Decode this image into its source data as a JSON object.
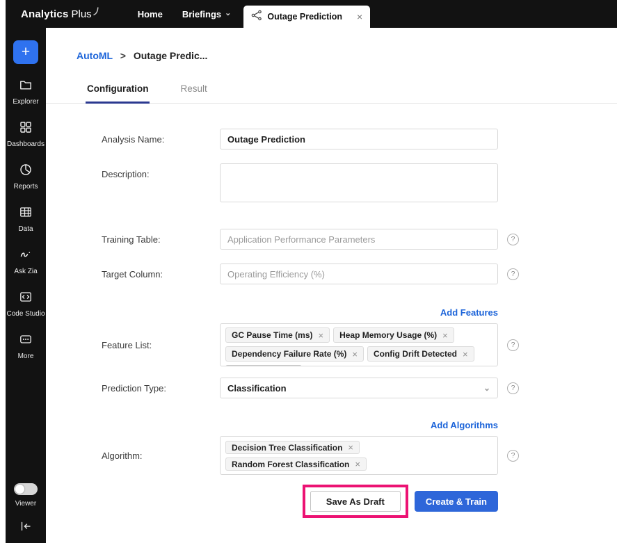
{
  "icons": {
    "close": "×",
    "chevron_down": "⌄",
    "help": "?",
    "plus": "+"
  },
  "topbar": {
    "brand_bold": "Analytics",
    "brand_light": "Plus",
    "nav": [
      {
        "label": "Home"
      },
      {
        "label": "Briefings"
      }
    ],
    "tab": {
      "label": "Outage Prediction"
    }
  },
  "sidebar": {
    "items": [
      {
        "label": "Explorer"
      },
      {
        "label": "Dashboards"
      },
      {
        "label": "Reports"
      },
      {
        "label": "Data"
      },
      {
        "label": "Ask Zia"
      },
      {
        "label": "Code Studio"
      },
      {
        "label": "More"
      }
    ],
    "viewer_label": "Viewer"
  },
  "breadcrumb": {
    "root": "AutoML",
    "separator": ">",
    "current": "Outage Predic..."
  },
  "tabs": [
    {
      "label": "Configuration"
    },
    {
      "label": "Result"
    }
  ],
  "form": {
    "analysis_name": {
      "label": "Analysis Name:",
      "value": "Outage Prediction"
    },
    "description": {
      "label": "Description:",
      "value": ""
    },
    "training_table": {
      "label": "Training Table:",
      "placeholder": "Application Performance Parameters"
    },
    "target_column": {
      "label": "Target Column:",
      "placeholder": "Operating Efficiency (%)"
    },
    "features": {
      "link": "Add Features",
      "label": "Feature List:",
      "chips": [
        "GC Pause Time (ms)",
        "Heap Memory Usage (%)",
        "Dependency Failure Rate (%)",
        "Config Drift Detected"
      ]
    },
    "prediction_type": {
      "label": "Prediction Type:",
      "value": "Classification"
    },
    "algorithms": {
      "link": "Add Algorithms",
      "label": "Algorithm:",
      "chips": [
        "Decision Tree Classification",
        "Random Forest Classification"
      ]
    }
  },
  "actions": {
    "save_draft": "Save As Draft",
    "create_train": "Create & Train"
  },
  "colors": {
    "accent_blue": "#1c64d9",
    "button_blue": "#2e66d9",
    "annotation_pink": "#ec1273",
    "bar_black": "#121212"
  }
}
